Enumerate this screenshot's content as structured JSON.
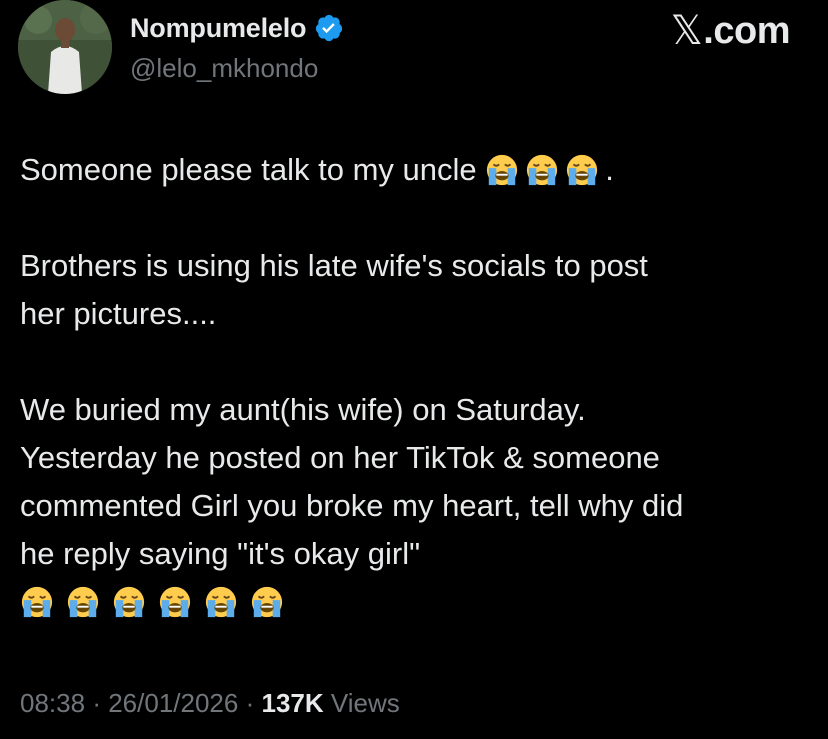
{
  "author": {
    "display_name": "Nompumelelo",
    "handle": "@lelo_mkhondo",
    "verified_badge_icon": "verified-badge-icon",
    "verified_color": "#1d9bf0"
  },
  "brand": {
    "mark": "𝕏",
    "text": ".com"
  },
  "tweet": {
    "line1": "Someone please talk to my uncle",
    "line1_suffix": ".",
    "line1_emoji_count": 3,
    "line2": "Brothers is using his late wife's socials to post",
    "line3": "her pictures....",
    "line4": "We buried my aunt(his wife) on Saturday.",
    "line5": "Yesterday he posted on her TikTok & someone",
    "line6": "commented Girl you broke my heart, tell why did",
    "line7": "he reply saying \"it's okay girl\"",
    "trailing_emoji_count": 6,
    "emoji_name": "loudly-crying-face-icon"
  },
  "meta": {
    "time": "08:38",
    "separator": "·",
    "date": "26/01/2026",
    "views_count": "137K",
    "views_label": "Views"
  },
  "colors": {
    "background": "#000000",
    "text_primary": "#e7e9ea",
    "text_secondary": "#71767b"
  }
}
